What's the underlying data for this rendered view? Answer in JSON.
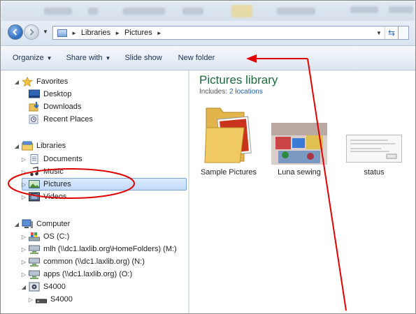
{
  "address_bar": {
    "breadcrumbs": [
      "Libraries",
      "Pictures"
    ],
    "icons": [
      "back-arrow-icon",
      "forward-arrow-icon",
      "library-icon",
      "refresh-icon"
    ]
  },
  "command_bar": {
    "organize": "Organize",
    "share_with": "Share with",
    "slide_show": "Slide show",
    "new_folder": "New folder"
  },
  "nav": {
    "favorites": {
      "label": "Favorites",
      "items": [
        "Desktop",
        "Downloads",
        "Recent Places"
      ]
    },
    "libraries": {
      "label": "Libraries",
      "items": [
        "Documents",
        "Music",
        "Pictures",
        "Videos"
      ],
      "selected": "Pictures"
    },
    "computer": {
      "label": "Computer",
      "items": [
        "OS (C:)",
        "mlh (\\\\dc1.laxlib.org\\HomeFolders) (M:)",
        "common (\\\\dc1.laxlib.org) (N:)",
        "apps (\\\\dc1.laxlib.org) (O:)"
      ]
    },
    "s4000": {
      "label": "S4000",
      "child": "S4000"
    }
  },
  "content": {
    "title": "Pictures library",
    "includes_label": "Includes:",
    "includes_link": "2 locations",
    "items": [
      {
        "name": "Sample Pictures",
        "kind": "folder"
      },
      {
        "name": "Luna sewing",
        "kind": "photo"
      },
      {
        "name": "status",
        "kind": "screenshot"
      }
    ]
  },
  "annotation": {
    "color": "#e00000"
  }
}
